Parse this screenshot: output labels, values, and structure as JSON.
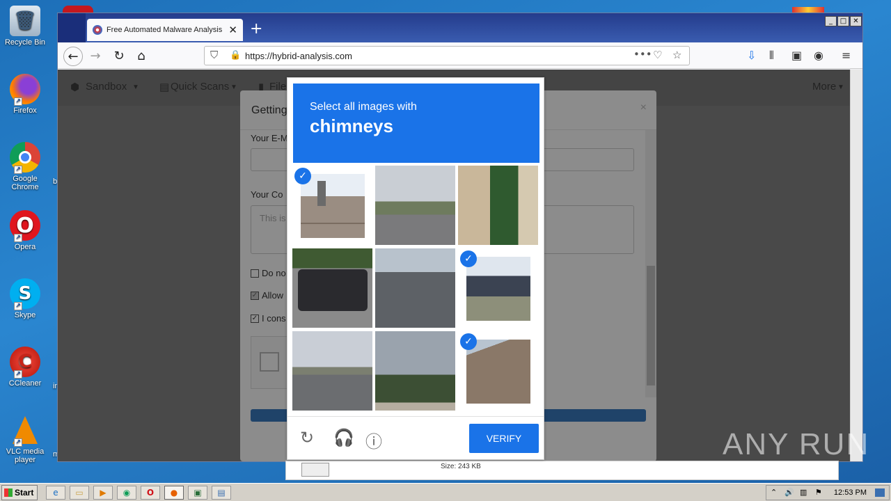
{
  "desktop": {
    "icons": [
      {
        "label": "Recycle Bin"
      },
      {
        "label": "Firefox"
      },
      {
        "label": "Google Chrome"
      },
      {
        "label": "Opera"
      },
      {
        "label": "Skype"
      },
      {
        "label": "CCleaner"
      },
      {
        "label": "VLC media player"
      }
    ],
    "side_letters": [
      "b",
      "in",
      "m"
    ]
  },
  "browser": {
    "tab_title": "Free Automated Malware Analysis",
    "url": "https://hybrid-analysis.com",
    "new_tab": "+"
  },
  "site": {
    "nav": [
      "Sandbox",
      "Quick Scans",
      "File",
      "More"
    ],
    "modal_title": "Getting",
    "email_label": "Your E-M",
    "comment_label": "Your Co",
    "comment_placeholder": "This is",
    "cb1_label": "Do no",
    "cb2_label": "Allow",
    "cb3_label": "I cons",
    "size_text": "Size: 243 KB"
  },
  "captcha": {
    "line1": "Select all images with",
    "line2": "chimneys",
    "verify_label": "VERIFY",
    "tiles": [
      {
        "selected": true,
        "desc": "roof-chimney"
      },
      {
        "selected": false,
        "desc": "highway-hills"
      },
      {
        "selected": false,
        "desc": "palm-building"
      },
      {
        "selected": false,
        "desc": "pickup-truck"
      },
      {
        "selected": false,
        "desc": "street"
      },
      {
        "selected": true,
        "desc": "house-chimney"
      },
      {
        "selected": false,
        "desc": "road-overpass"
      },
      {
        "selected": false,
        "desc": "trees-sky"
      },
      {
        "selected": true,
        "desc": "roof"
      }
    ]
  },
  "taskbar": {
    "start": "Start",
    "clock": "12:53 PM"
  },
  "watermark": "ANY RUN"
}
